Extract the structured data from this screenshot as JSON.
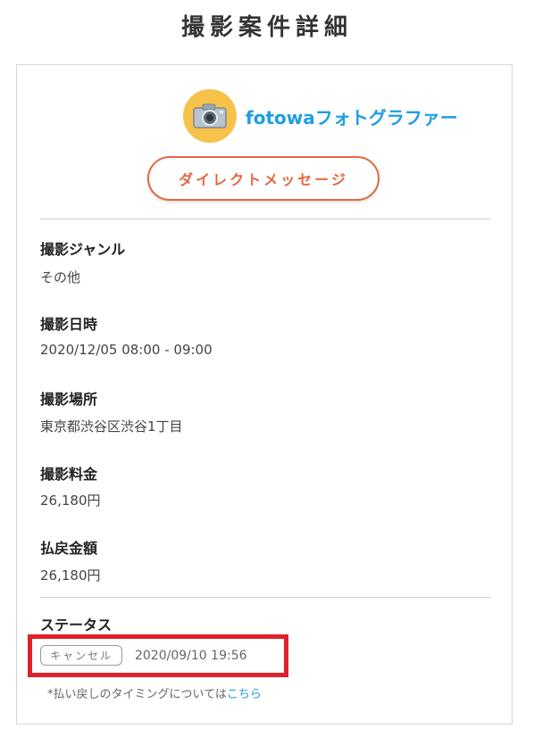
{
  "page": {
    "title": "撮影案件詳細"
  },
  "photographer": {
    "name": "fotowaフォトグラファー",
    "avatar_icon": "camera-icon"
  },
  "dm_button": {
    "label": "ダイレクトメッセージ"
  },
  "details": [
    {
      "label": "撮影ジャンル",
      "value": "その他"
    },
    {
      "label": "撮影日時",
      "value": "2020/12/05 08:00 - 09:00"
    },
    {
      "label": "撮影場所",
      "value": "東京都渋谷区渋谷1丁目"
    },
    {
      "label": "撮影料金",
      "value": "26,180円"
    },
    {
      "label": "払戻金額",
      "value": "26,180円"
    }
  ],
  "status": {
    "label": "ステータス",
    "badge": "キャンセル",
    "timestamp": "2020/09/10 19:56"
  },
  "refund_note": {
    "text": "*払い戻しのタイミングについては",
    "link": "こちら"
  },
  "colors": {
    "accent_orange": "#e5673f",
    "link_blue": "#1e9ee0",
    "avatar_yellow": "#f6c24a",
    "highlight_red": "#e0202a"
  }
}
